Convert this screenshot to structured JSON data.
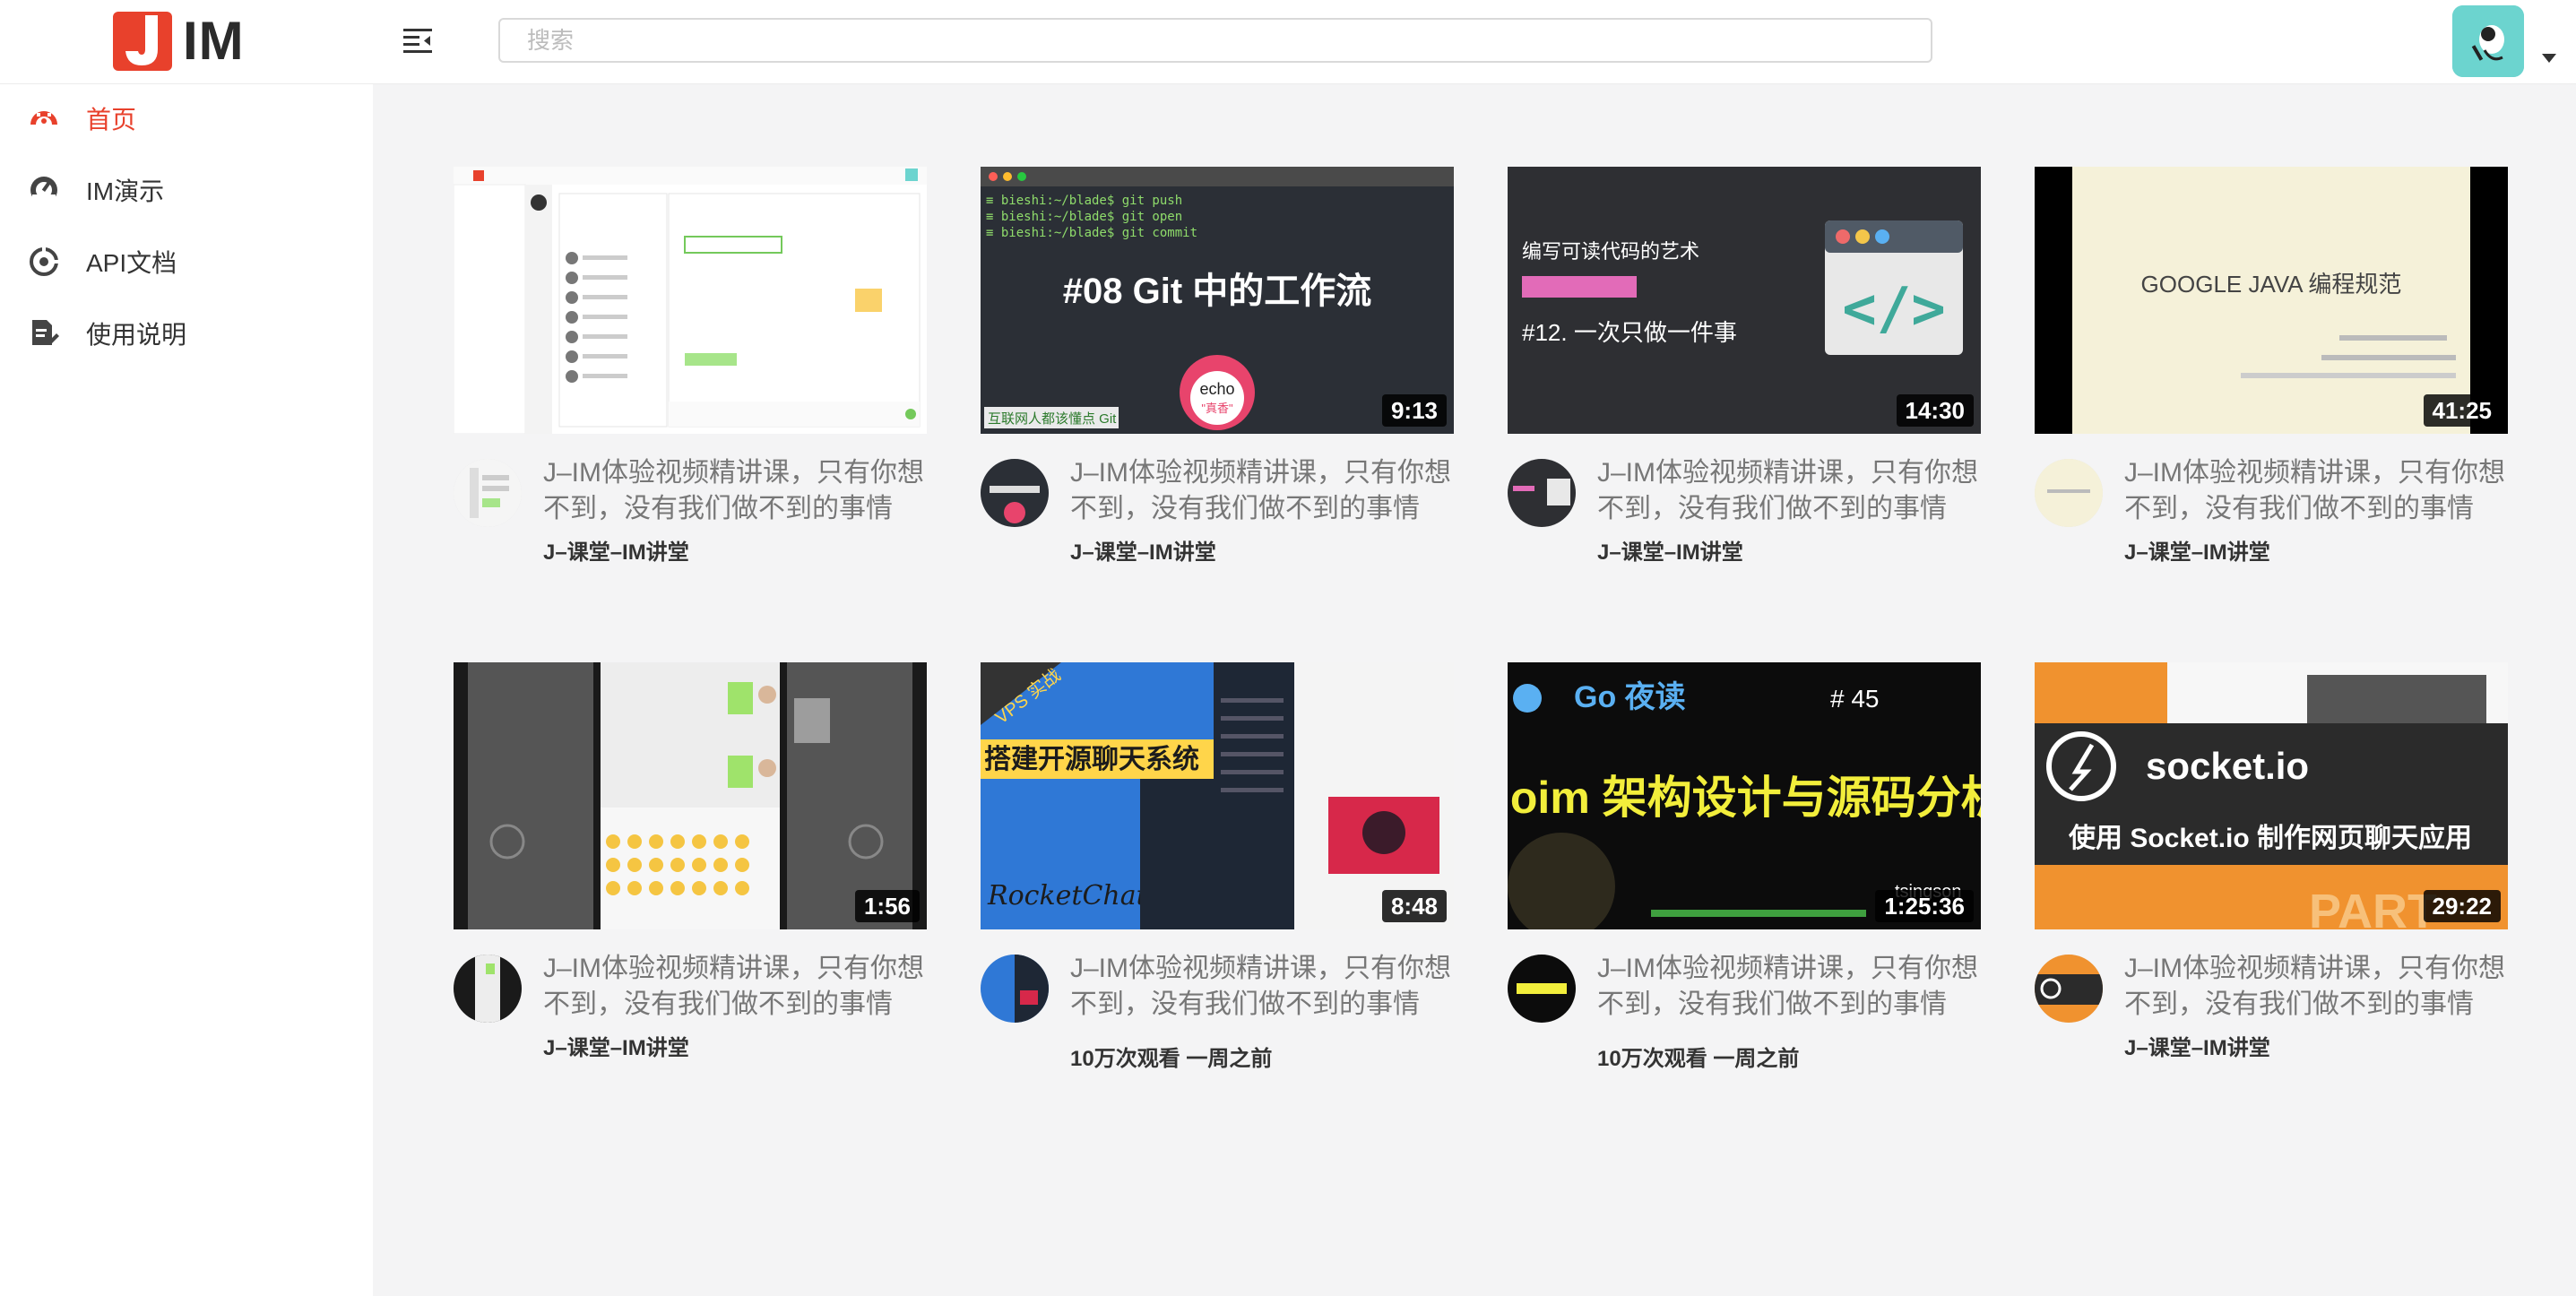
{
  "app": {
    "logo_text": "IM"
  },
  "header": {
    "search_placeholder": "搜索"
  },
  "sidebar": {
    "items": [
      {
        "label": "首页",
        "icon": "dashboard-icon",
        "active": true
      },
      {
        "label": "IM演示",
        "icon": "gauge-icon",
        "active": false
      },
      {
        "label": "API文档",
        "icon": "compass-icon",
        "active": false
      },
      {
        "label": "使用说明",
        "icon": "document-edit-icon",
        "active": false
      }
    ]
  },
  "colors": {
    "accent": "#e8412c",
    "avatar_bg": "#6cd4cf",
    "main_bg": "#f4f4f5"
  },
  "videos": [
    {
      "duration": "",
      "title": "J–IM体验视频精讲课，只有你想不到，没有我们做不到的事情",
      "meta": "J–课堂–IM讲堂"
    },
    {
      "duration": "9:13",
      "title": "J–IM体验视频精讲课，只有你想不到，没有我们做不到的事情",
      "meta": "J–课堂–IM讲堂",
      "thumb_text": "#08 Git 中的工作流",
      "thumb_caption": "互联网人都该懂点 Git",
      "thumb_badge_1": "echo",
      "thumb_badge_2": "\"真香\"",
      "thumb_lines": [
        "≡ bieshi:~/blade$ git push",
        "≡ bieshi:~/blade$ git open",
        "≡ bieshi:~/blade$ git commit"
      ]
    },
    {
      "duration": "14:30",
      "title": "J–IM体验视频精讲课，只有你想不到，没有我们做不到的事情",
      "meta": "J–课堂–IM讲堂",
      "thumb_text": "编写可读代码的艺术",
      "thumb_sub": "#12. 一次只做一件事"
    },
    {
      "duration": "41:25",
      "title": "J–IM体验视频精讲课，只有你想不到，没有我们做不到的事情",
      "meta": "J–课堂–IM讲堂",
      "thumb_text": "GOOGLE JAVA 编程规范"
    },
    {
      "duration": "1:56",
      "title": "J–IM体验视频精讲课，只有你想不到，没有我们做不到的事情",
      "meta": "J–课堂–IM讲堂"
    },
    {
      "duration": "8:48",
      "title": "J–IM体验视频精讲课，只有你想不到，没有我们做不到的事情",
      "meta": "10万次观看 一周之前",
      "thumb_text": "搭建开源聊天系统",
      "thumb_sub": "VPS 实战",
      "thumb_caption": "RocketChat"
    },
    {
      "duration": "1:25:36",
      "title": "J–IM体验视频精讲课，只有你想不到，没有我们做不到的事情",
      "meta": "10万次观看 一周之前",
      "thumb_text": "goim 架构设计与源码分析",
      "thumb_sub": "Go 夜读",
      "thumb_num": "# 45",
      "thumb_caption": "tsingson"
    },
    {
      "duration": "29:22",
      "title": "J–IM体验视频精讲课，只有你想不到，没有我们做不到的事情",
      "meta": "J–课堂–IM讲堂",
      "thumb_text": "使用 Socket.io 制作网页聊天应用",
      "thumb_sub": "socket.io",
      "thumb_caption": "PART"
    }
  ]
}
